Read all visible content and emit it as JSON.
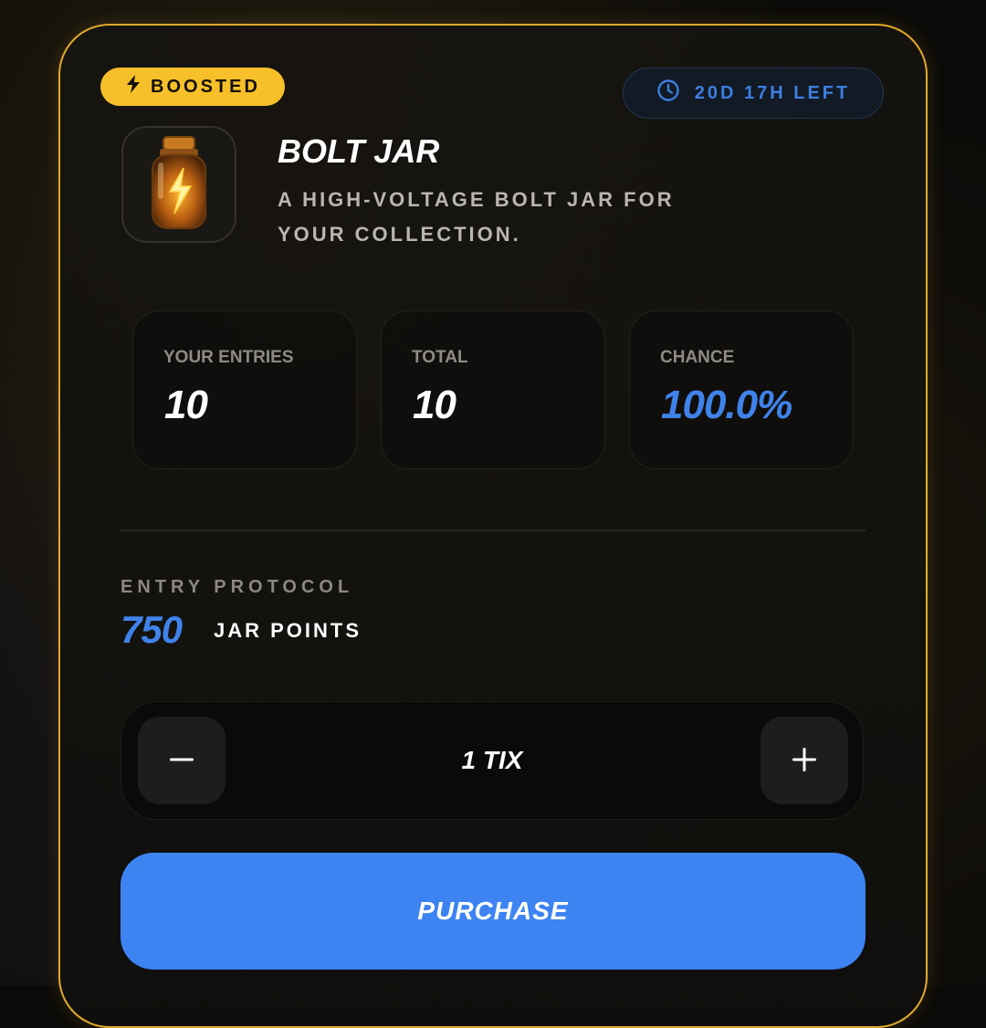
{
  "badge": {
    "label": "BOOSTED",
    "icon": "lightning-icon",
    "color": "#f7c02a"
  },
  "timer": {
    "label": "20D 17H LEFT",
    "icon": "clock-icon",
    "color": "#3f83ea"
  },
  "item": {
    "title": "BOLT JAR",
    "description": "A HIGH-VOLTAGE BOLT JAR FOR YOUR COLLECTION.",
    "image_icon": "jar-icon"
  },
  "stats": [
    {
      "label": "YOUR ENTRIES",
      "value": "10"
    },
    {
      "label": "TOTAL",
      "value": "10"
    },
    {
      "label": "CHANCE",
      "value": "100.0%"
    }
  ],
  "entry": {
    "label": "ENTRY PROTOCOL",
    "amount": "750",
    "unit": "JAR POINTS"
  },
  "stepper": {
    "decrement_icon": "minus-icon",
    "increment_icon": "plus-icon",
    "quantity": "1 TIX"
  },
  "purchase_label": "PURCHASE",
  "colors": {
    "accent_blue": "#3d83f2",
    "border_gold": "#e0a92a"
  }
}
